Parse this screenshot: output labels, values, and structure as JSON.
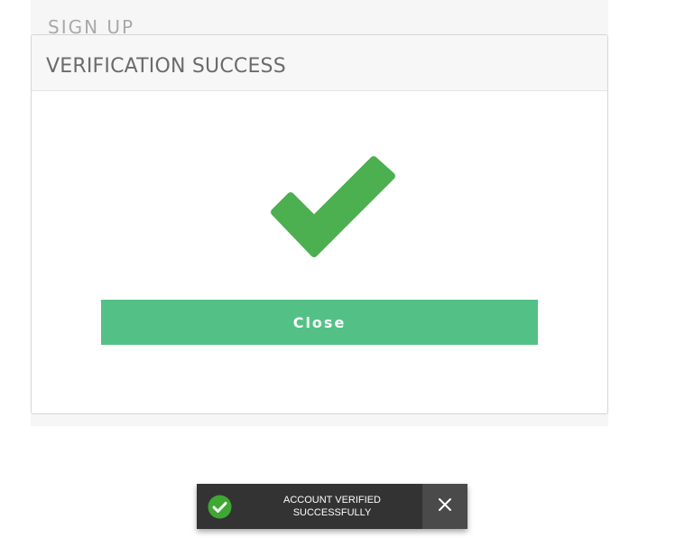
{
  "background": {
    "title": "SIGN UP"
  },
  "modal": {
    "title": "VERIFICATION SUCCESS",
    "icon": "checkmark-icon",
    "close_label": "Close"
  },
  "toast": {
    "icon": "check-circle-icon",
    "message_line1": "ACCOUNT VERIFIED",
    "message_line2": "SUCCESSFULLY",
    "dismiss_icon": "close-icon"
  },
  "colors": {
    "success_green": "#4caf50",
    "button_green": "#53c186",
    "toast_bg": "#333333",
    "toast_close_bg": "#4a4a4a"
  }
}
